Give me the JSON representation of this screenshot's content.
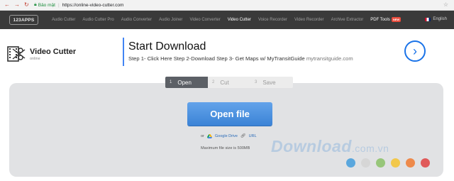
{
  "browser": {
    "secure_label": "Bảo mật",
    "url": "https://online-video-cutter.com"
  },
  "topnav": {
    "logo": "123APPS",
    "items": [
      {
        "label": "Audio Cutter"
      },
      {
        "label": "Audio Cutter Pro"
      },
      {
        "label": "Audio Converter"
      },
      {
        "label": "Audio Joiner"
      },
      {
        "label": "Video Converter"
      },
      {
        "label": "Video Cutter"
      },
      {
        "label": "Voice Recorder"
      },
      {
        "label": "Video Recorder"
      },
      {
        "label": "Archive Extractor"
      },
      {
        "label": "PDF Tools"
      }
    ],
    "active_item": "Video Cutter",
    "new_badge": "NEW",
    "language": "English"
  },
  "app": {
    "name": "Video Cutter",
    "subtitle": "online"
  },
  "ad": {
    "headline": "Start Download",
    "description": "Step 1- Click Here Step 2-Download Step 3- Get Maps w/ MyTransitGuide",
    "domain": "mytransitguide.com"
  },
  "steps": [
    {
      "num": "1",
      "label": "Open"
    },
    {
      "num": "2",
      "label": "Cut"
    },
    {
      "num": "3",
      "label": "Save"
    }
  ],
  "main": {
    "open_button": "Open file",
    "or_label": "or",
    "google_drive": "Google Drive",
    "url_label": "URL",
    "max_size": "Maximum file size is 500MB"
  },
  "watermark": {
    "text": "Download",
    "suffix": ".com.vn"
  },
  "colors": {
    "accent": "#4a90e2",
    "nav_bg": "#3a3a3a",
    "panel_bg": "#e1e2e4",
    "dot_colors": [
      "#5aa7dd",
      "#d6d6d6",
      "#97c67a",
      "#f2c84b",
      "#ee8a4b",
      "#e05a5a"
    ]
  }
}
